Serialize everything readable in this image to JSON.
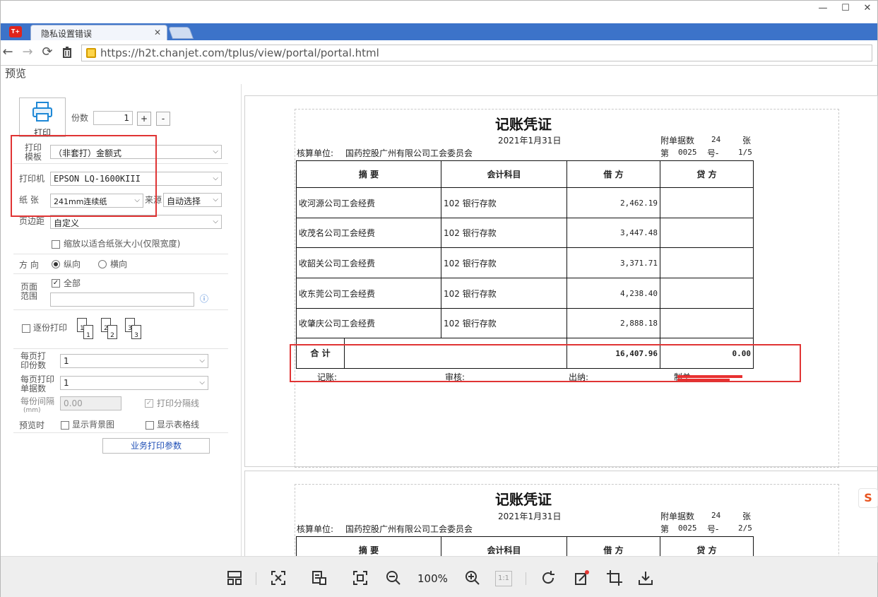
{
  "window": {
    "minimize": "—",
    "maximize": "☐",
    "close": "✕"
  },
  "tab": {
    "app_icon_text": "T+",
    "title": "隐私设置错误",
    "close": "✕"
  },
  "nav": {
    "back": "←",
    "forward": "→",
    "reload": "⟳",
    "url": "https://h2t.chanjet.com/tplus/view/portal/portal.html"
  },
  "preview_title": "预览",
  "panel": {
    "print_label": "打印",
    "copies_label": "份数",
    "copies_value": "1",
    "plus": "+",
    "minus": "-",
    "template_label": "打印模板",
    "template_value": "（非套打）金额式",
    "printer_label": "打印机",
    "printer_value": "EPSON LQ-1600KIII",
    "paper_label": "纸 张",
    "paper_value": "241mm连续纸",
    "source_label": "来源",
    "source_value": "自动选择",
    "margin_label": "页边距",
    "margin_value": "自定义",
    "fit_label": "缩放以适合纸张大小(仅限宽度)",
    "orientation_label": "方 向",
    "portrait": "纵向",
    "landscape": "横向",
    "range_label": "页面范围",
    "all_label": "全部",
    "collate_label": "逐份打印",
    "per_page_copies_label": "每页打印份数",
    "per_page_copies_value": "1",
    "per_page_docs_label": "每页打印单据数",
    "per_page_docs_value": "1",
    "gap_label": "每份间隔",
    "gap_unit": "(mm)",
    "gap_value": "0.00",
    "divider_label": "打印分隔线",
    "preview_label": "预览时",
    "show_bg": "显示背景图",
    "show_grid": "显示表格线",
    "biz_button": "业务打印参数",
    "page_icons": [
      "1",
      "1",
      "2",
      "2",
      "3",
      "3"
    ]
  },
  "voucher": {
    "title": "记账凭证",
    "date": "2021年1月31日",
    "attach_label": "附单据数",
    "attach_count": "24",
    "attach_unit": "张",
    "unit_label": "核算单位:",
    "unit_name": "国药控股广州有限公司工会委员会",
    "no_prefix": "第",
    "no_value": "0025",
    "no_suffix": "号-",
    "page1": "1/5",
    "page2": "2/5",
    "headers": [
      "摘 要",
      "会计科目",
      "借 方",
      "贷 方"
    ],
    "rows": [
      {
        "summary": "收河源公司工会经费",
        "account": "102 银行存款",
        "debit": "2,462.19",
        "credit": ""
      },
      {
        "summary": "收茂名公司工会经费",
        "account": "102 银行存款",
        "debit": "3,447.48",
        "credit": ""
      },
      {
        "summary": "收韶关公司工会经费",
        "account": "102 银行存款",
        "debit": "3,371.71",
        "credit": ""
      },
      {
        "summary": "收东莞公司工会经费",
        "account": "102 银行存款",
        "debit": "4,238.40",
        "credit": ""
      },
      {
        "summary": "收肇庆公司工会经费",
        "account": "102 银行存款",
        "debit": "2,888.18",
        "credit": ""
      }
    ],
    "total_label": "合 计",
    "total_debit": "16,407.96",
    "total_credit": "0.00",
    "footer_bookkeeper": "记账:",
    "footer_auditor": "审核:",
    "footer_cashier": "出纳:",
    "footer_maker": "制单:"
  },
  "toolbar": {
    "zoom": "100%",
    "actual_size": "1:1"
  },
  "ime_icon": "S",
  "colors": {
    "tab_strip": "#3c73c9",
    "highlight": "#e03434",
    "link": "#1f4fb6"
  }
}
